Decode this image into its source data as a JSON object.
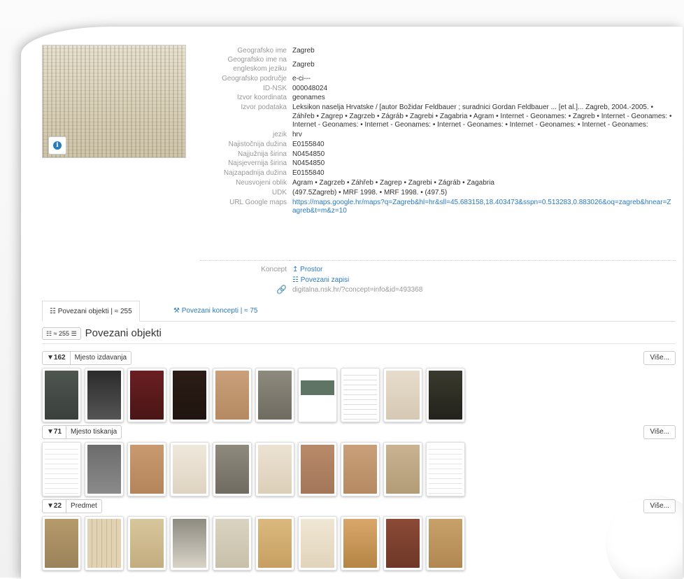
{
  "meta_rows": [
    {
      "key": "Geografsko ime",
      "value": "Zagreb"
    },
    {
      "key": "Geografsko ime na engleskom jeziku",
      "value": "Zagreb"
    },
    {
      "key": "Geografsko područje",
      "value": "e-ci---"
    },
    {
      "key": "ID-NSK",
      "value": "000048024"
    },
    {
      "key": "Izvor koordinata",
      "value": "geonames"
    },
    {
      "key": "Izvor podataka",
      "value": "Leksikon naselja Hrvatske / [autor Božidar Feldbauer ; suradnici Gordan Feldbauer ... [et al.]... Zagreb, 2004.-2005.  • Záhřeb  • Zagrep  • Zagrzeb  • Zágráb  • Zagrebi  • Zagabria  • Agram  • Internet - Geonames:  • Zagreb  • Internet - Geonames:  • Internet - Geonames:  • Internet - Geonames:  • Internet - Geonames:  • Internet - Geonames:  • Internet - Geonames:"
    },
    {
      "key": "jezik",
      "value": "hrv"
    },
    {
      "key": "Najistočnija dužina",
      "value": "E0155840"
    },
    {
      "key": "Najjužnija širina",
      "value": "N0454850"
    },
    {
      "key": "Najsjevernija širina",
      "value": "N0454850"
    },
    {
      "key": "Najzapadnija dužina",
      "value": "E0155840"
    },
    {
      "key": "Neusvojeni oblik",
      "value": "Agram  • Zagrzeb  • Záhřeb  • Zagrep  • Zagrebi  • Zágráb  • Zagabria"
    },
    {
      "key": "UDK",
      "value": "(497.5Zagreb)  • MRF 1998.  • MRF 1998.  • (497.5)"
    },
    {
      "key": "URL Google maps",
      "value": "https://maps.google.hr/maps?q=Zagreb&hl=hr&sll=45.683158,18.403473&sspn=0.513283,0.883026&oq=zagreb&hnear=Zagreb&t=m&z=10"
    }
  ],
  "concept": {
    "key": "Koncept",
    "prostor": "↥ Prostor",
    "povezani_zapisi": "Povezani zapisi",
    "permalink": "digitalna.nsk.hr/?concept=info&id=493368"
  },
  "tabs": [
    {
      "label": "Povezani objekti | ≈ 255",
      "active": true
    },
    {
      "label": "Povezani koncepti | ≈ 75",
      "active": false
    }
  ],
  "section": {
    "count": "≈ 255",
    "title": "Povezani objekti"
  },
  "groups": [
    {
      "count": "162",
      "label": "Mjesto izdavanja",
      "more": "Više..."
    },
    {
      "count": "71",
      "label": "Mjesto tiskanja",
      "more": "Više..."
    },
    {
      "count": "22",
      "label": "Predmet",
      "more": "Više..."
    }
  ],
  "colors": {
    "link": "#2a7ac0",
    "label": "#999999",
    "border": "#dddddd"
  }
}
